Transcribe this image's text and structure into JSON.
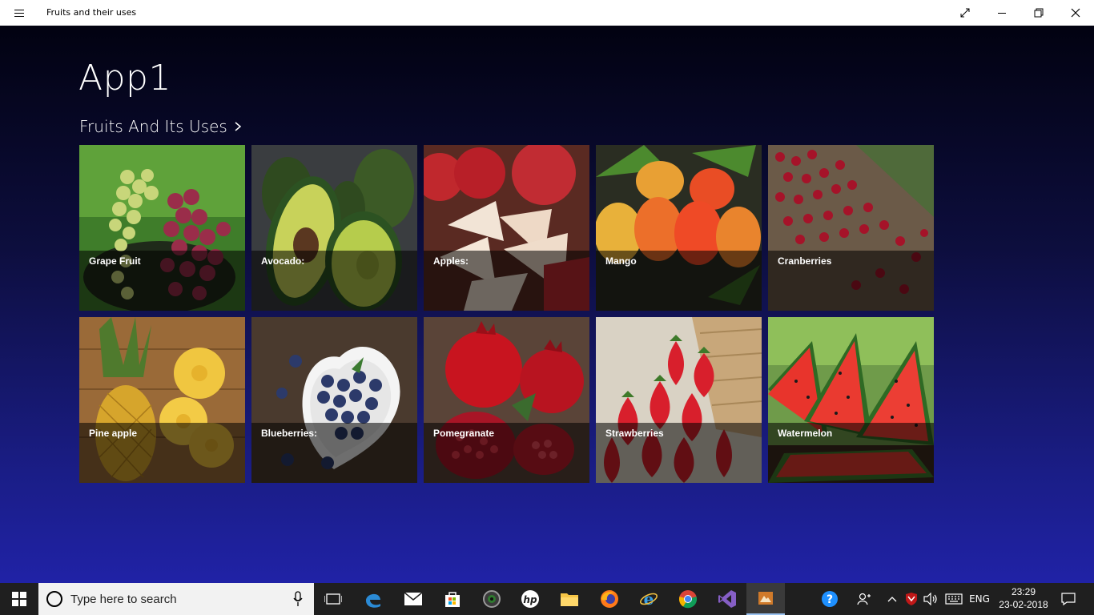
{
  "window": {
    "title": "Fruits and their uses"
  },
  "app": {
    "title": "App1",
    "section_header": "Fruits And Its Uses"
  },
  "tiles": [
    {
      "label": "Grape Fruit"
    },
    {
      "label": "Avocado:"
    },
    {
      "label": "Apples:"
    },
    {
      "label": "Mango"
    },
    {
      "label": "Cranberries"
    },
    {
      "label": "Pine apple"
    },
    {
      "label": "Blueberries:"
    },
    {
      "label": "Pomegranate"
    },
    {
      "label": "Strawberries"
    },
    {
      "label": "Watermelon"
    }
  ],
  "taskbar": {
    "search_placeholder": "Type here to search",
    "language": "ENG",
    "time": "23:29",
    "date": "23-02-2018",
    "pinned_icons": [
      "task-view-icon",
      "edge-icon",
      "mail-icon",
      "store-icon",
      "camera-app-icon",
      "hp-icon",
      "file-explorer-icon",
      "firefox-icon",
      "internet-explorer-icon",
      "chrome-icon",
      "visual-studio-icon",
      "running-app-icon"
    ]
  },
  "colors": {
    "app_background_top": "#020211",
    "app_background_bottom": "#2022a6",
    "taskbar": "#1f1f1f"
  }
}
